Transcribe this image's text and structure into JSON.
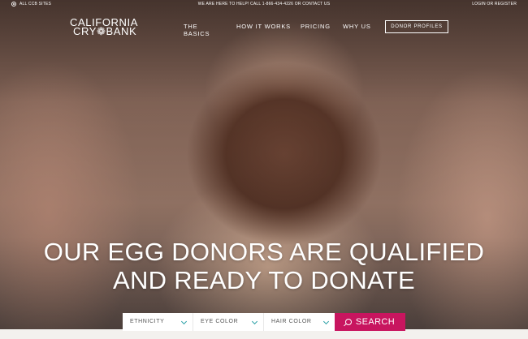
{
  "topbar": {
    "sites_label": "ALL CCB SITES",
    "help_text": "WE ARE HERE TO HELP! CALL 1-866-434-4226 OR CONTACT US",
    "login_label": "LOGIN OR REGISTER"
  },
  "logo": {
    "line1": "CALIFORNIA",
    "line2": "CRY❁BANK"
  },
  "nav": {
    "items": [
      {
        "label": "THE BASICS"
      },
      {
        "label": "HOW IT WORKS"
      },
      {
        "label": "PRICING"
      },
      {
        "label": "WHY US"
      }
    ],
    "donor_profiles": "DONOR PROFILES"
  },
  "hero": {
    "headline_line1": "OUR EGG DONORS ARE QUALIFIED",
    "headline_line2": "AND READY TO DONATE"
  },
  "search": {
    "filters": [
      {
        "label": "ETHNICITY"
      },
      {
        "label": "EYE COLOR"
      },
      {
        "label": "HAIR COLOR"
      }
    ],
    "button_label": "SEARCH"
  },
  "colors": {
    "accent": "#c8155f",
    "chevron": "#2aa0a6"
  },
  "icons": [
    "globe-icon",
    "chevron-down-icon",
    "search-icon"
  ]
}
